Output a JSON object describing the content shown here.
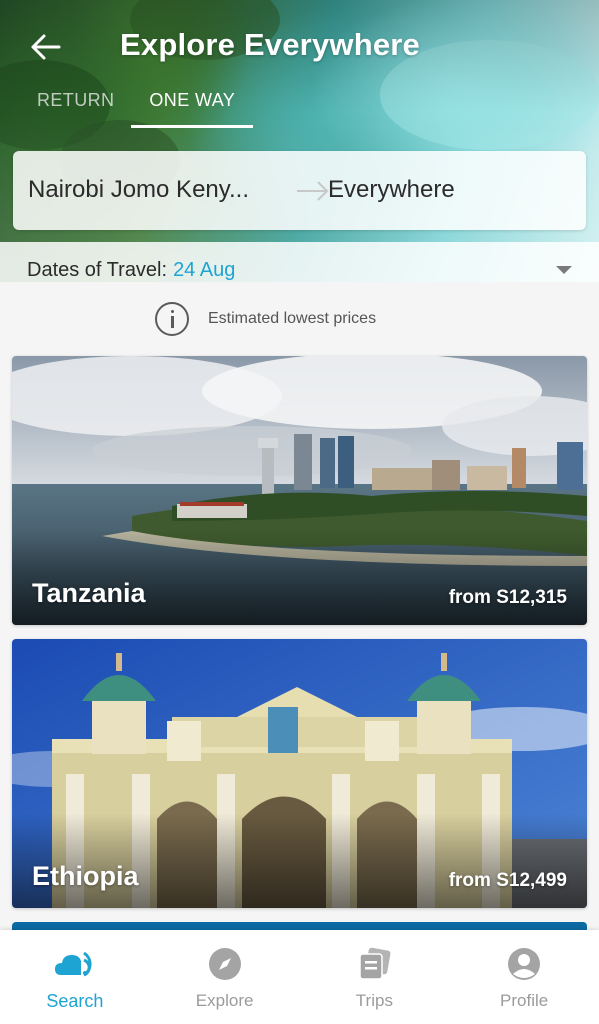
{
  "header": {
    "title": "Explore Everywhere",
    "tabs": [
      {
        "label": "RETURN",
        "active": false
      },
      {
        "label": "ONE WAY",
        "active": true
      }
    ]
  },
  "route": {
    "from": "Nairobi Jomo Keny...",
    "to": "Everywhere"
  },
  "dates": {
    "label": "Dates of Travel:",
    "value": "24 Aug"
  },
  "info": {
    "text": "Estimated lowest prices"
  },
  "destinations": [
    {
      "name": "Tanzania",
      "price": "from S12,315"
    },
    {
      "name": "Ethiopia",
      "price": "from S12,499"
    }
  ],
  "bottom_nav": [
    {
      "label": "Search",
      "icon": "search-cloud-icon",
      "active": true
    },
    {
      "label": "Explore",
      "icon": "compass-icon",
      "active": false
    },
    {
      "label": "Trips",
      "icon": "trips-cards-icon",
      "active": false
    },
    {
      "label": "Profile",
      "icon": "profile-icon",
      "active": false
    }
  ],
  "colors": {
    "accent": "#1ea4d3",
    "inactive": "#9b9b9b"
  }
}
